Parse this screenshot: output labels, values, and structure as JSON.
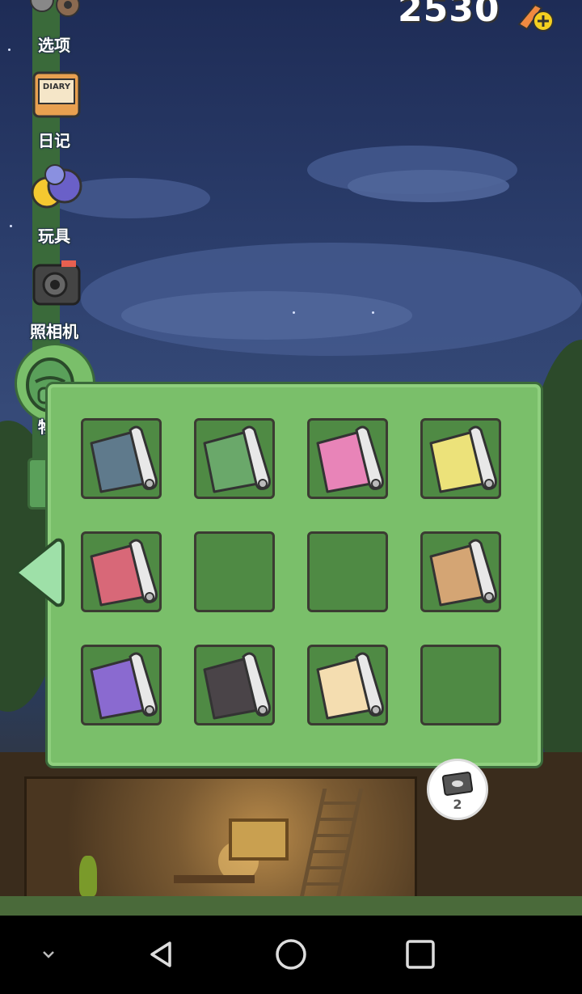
{
  "currency": {
    "amount": "2530"
  },
  "menu": {
    "items": [
      {
        "id": "options",
        "label": "选项",
        "icon": "gear-icon"
      },
      {
        "id": "diary",
        "label": "日记",
        "icon": "diary-icon",
        "icon_text": "DIARY"
      },
      {
        "id": "toys",
        "label": "玩具",
        "icon": "toy-balls-icon"
      },
      {
        "id": "camera",
        "label": "照相机",
        "icon": "camera-icon"
      },
      {
        "id": "items",
        "label": "物品",
        "icon": "backpack-icon"
      }
    ]
  },
  "inventory": {
    "slots": [
      {
        "name": "cloth-blue-mat",
        "color": "#5f7a8c",
        "empty": false
      },
      {
        "name": "cloth-green-leaf",
        "color": "#6aa86a",
        "empty": false
      },
      {
        "name": "cloth-pink-hearts",
        "color": "#e884b8",
        "empty": false
      },
      {
        "name": "cloth-yellow-banana",
        "color": "#ece27a",
        "empty": false
      },
      {
        "name": "cloth-red-pattern",
        "color": "#d86878",
        "empty": false
      },
      {
        "name": "empty-slot",
        "empty": true
      },
      {
        "name": "empty-slot",
        "empty": true
      },
      {
        "name": "cloth-tan-wood",
        "color": "#d4a574",
        "empty": false
      },
      {
        "name": "cloth-purple-sakura",
        "color": "#8a6ad0",
        "empty": false
      },
      {
        "name": "cloth-black-sakura",
        "color": "#4a4448",
        "empty": false
      },
      {
        "name": "cloth-carrot",
        "color": "#f4ddb0",
        "empty": false
      },
      {
        "name": "empty-slot",
        "empty": true
      }
    ]
  },
  "badge": {
    "count": "2",
    "icon": "ticket-icon"
  },
  "colors": {
    "panel": "#7abf6a",
    "slot": "#4f8a44",
    "border": "#3b6a3a"
  },
  "nav": {
    "buttons": [
      "chevron-down-icon",
      "back-icon",
      "home-icon",
      "recents-icon"
    ]
  }
}
